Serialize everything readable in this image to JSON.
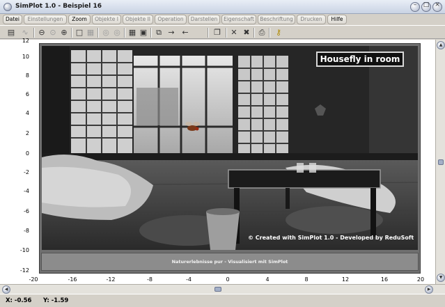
{
  "window": {
    "title": "SimPlot 1.0 - Beispiel 16",
    "min_glyph": "–",
    "max_glyph": "□",
    "close_glyph": "×"
  },
  "menu": [
    {
      "label": "Datei",
      "enabled": true
    },
    {
      "label": "Einstellungen",
      "enabled": false
    },
    {
      "label": "Zoom",
      "enabled": true
    },
    {
      "label": "Objekte I",
      "enabled": false
    },
    {
      "label": "Objekte II",
      "enabled": false
    },
    {
      "label": "Operation",
      "enabled": false
    },
    {
      "label": "Darstellen",
      "enabled": false
    },
    {
      "label": "Eigenschaft",
      "enabled": false
    },
    {
      "label": "Beschriftung",
      "enabled": false
    },
    {
      "label": "Drucken",
      "enabled": false
    },
    {
      "label": "Hilfe",
      "enabled": true
    }
  ],
  "toolbar": [
    {
      "name": "calculator-icon",
      "glyph": "▤",
      "enabled": true
    },
    {
      "name": "plot-curve-icon",
      "glyph": "∿",
      "enabled": false
    },
    {
      "name": "zoom-out-icon",
      "glyph": "⊖",
      "enabled": true
    },
    {
      "name": "zoom-fit-icon",
      "glyph": "⊙",
      "enabled": false
    },
    {
      "name": "zoom-in-icon",
      "glyph": "⊕",
      "enabled": true
    },
    {
      "name": "square-icon",
      "glyph": "□",
      "enabled": true
    },
    {
      "name": "grid-icon",
      "glyph": "▦",
      "enabled": false
    },
    {
      "name": "target-icon",
      "glyph": "◎",
      "enabled": false
    },
    {
      "name": "target-alt-icon",
      "glyph": "◎",
      "enabled": false
    },
    {
      "name": "table-icon",
      "glyph": "▦",
      "enabled": true
    },
    {
      "name": "image-icon",
      "glyph": "▣",
      "enabled": true
    },
    {
      "name": "copy-icon",
      "glyph": "⧉",
      "enabled": true
    },
    {
      "name": "arrow-right-icon",
      "glyph": "→",
      "enabled": true
    },
    {
      "name": "arrow-left-icon",
      "glyph": "←",
      "enabled": true
    },
    {
      "name": "document-icon",
      "glyph": "❐",
      "enabled": true
    },
    {
      "name": "cross-icon",
      "glyph": "✕",
      "enabled": true
    },
    {
      "name": "cross-all-icon",
      "glyph": "✖",
      "enabled": true
    },
    {
      "name": "printer-icon",
      "glyph": "⎙",
      "enabled": true
    },
    {
      "name": "help-key-icon",
      "glyph": "⚷",
      "enabled": true
    }
  ],
  "axis": {
    "x_ticks": [
      "-20",
      "-16",
      "-12",
      "-8",
      "-4",
      "0",
      "4",
      "8",
      "12",
      "16",
      "20"
    ],
    "y_ticks": [
      "12",
      "10",
      "8",
      "6",
      "4",
      "2",
      "0",
      "-2",
      "-4",
      "-6",
      "-8",
      "-10",
      "-12"
    ]
  },
  "picture": {
    "title": "Housefly in room",
    "credit": "© Created with SimPlot 1.0 - Developed by ReduSoft",
    "caption": "Naturerlebnisse pur - Visualisiert mit SimPlot"
  },
  "status": {
    "x": "X: -0.56",
    "y": "Y: -1.59"
  },
  "scrollbar_glyphs": {
    "up": "▲",
    "down": "▼",
    "left": "◀",
    "right": "▶"
  }
}
